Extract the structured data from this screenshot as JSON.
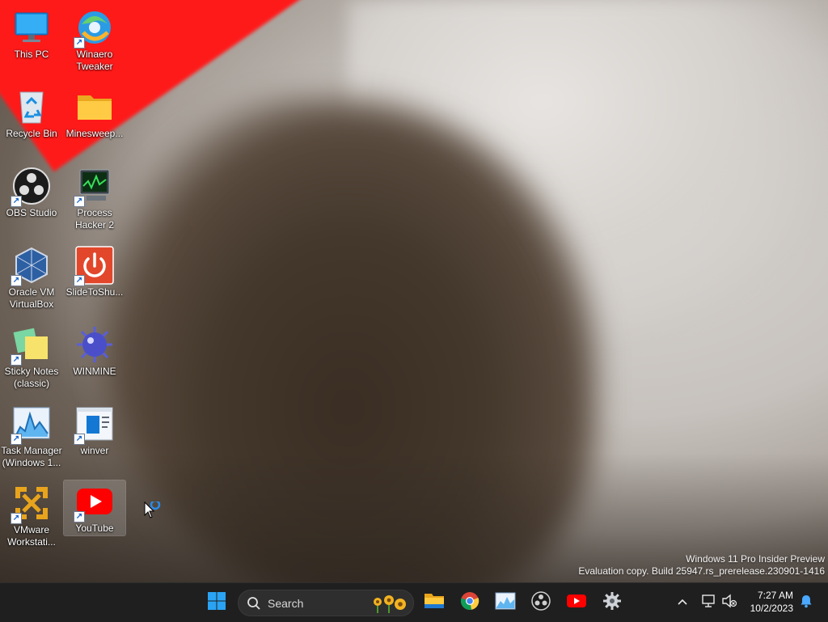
{
  "desktop": {
    "icons": [
      {
        "label": "This PC",
        "icon": "this-pc-icon",
        "shortcut": false
      },
      {
        "label": "Winaero Tweaker",
        "icon": "winaero-tweaker-icon",
        "shortcut": true
      },
      {
        "label": "Recycle Bin",
        "icon": "recycle-bin-icon",
        "shortcut": false
      },
      {
        "label": "Minesweep...",
        "icon": "folder-icon",
        "shortcut": false
      },
      {
        "label": "OBS Studio",
        "icon": "obs-studio-icon",
        "shortcut": true
      },
      {
        "label": "Process Hacker 2",
        "icon": "process-hacker-icon",
        "shortcut": true
      },
      {
        "label": "Oracle VM VirtualBox",
        "icon": "virtualbox-icon",
        "shortcut": true
      },
      {
        "label": "SlideToShu...",
        "icon": "slide-to-shutdown-icon",
        "shortcut": true
      },
      {
        "label": "Sticky Notes (classic)",
        "icon": "sticky-notes-icon",
        "shortcut": true
      },
      {
        "label": "WINMINE",
        "icon": "winmine-icon",
        "shortcut": false
      },
      {
        "label": "Task Manager (Windows 1...",
        "icon": "task-manager-icon",
        "shortcut": true
      },
      {
        "label": "winver",
        "icon": "winver-icon",
        "shortcut": true
      },
      {
        "label": "VMware Workstati...",
        "icon": "vmware-icon",
        "shortcut": true
      },
      {
        "label": "YouTube",
        "icon": "youtube-icon",
        "shortcut": true,
        "selected": true
      }
    ]
  },
  "watermark": {
    "line1": "Windows 11 Pro Insider Preview",
    "line2": "Evaluation copy. Build 25947.rs_prerelease.230901-1416"
  },
  "taskbar": {
    "search_placeholder": "Search",
    "pinned": [
      "start-icon",
      "file-explorer-icon",
      "chrome-icon",
      "task-manager-icon",
      "obs-studio-icon",
      "youtube-icon",
      "settings-gear-icon"
    ],
    "tray": {
      "time": "7:27 AM",
      "date": "10/2/2023"
    }
  },
  "colors": {
    "taskbar_bg": "#1f1f1f",
    "accent": "#0078d4",
    "wallpaper_red": "#ff1a1a"
  }
}
